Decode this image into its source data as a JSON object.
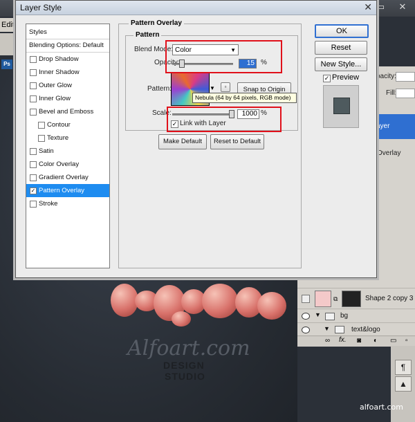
{
  "photoshop": {
    "menu_edit": "Edit",
    "app_badge": "Ps",
    "win_controls": [
      "—",
      "▭",
      "✕"
    ],
    "panel_opacity_label": "pacity:",
    "panel_fill_label": "Fill:",
    "selected_layer_fragment": "ayer",
    "overlay_fragment": "Overlay",
    "layers": [
      {
        "name": "Shape 2 copy 3"
      },
      {
        "name": "bg"
      },
      {
        "name": "text&logo"
      }
    ],
    "footer_icons": [
      "link-icon",
      "fx-icon",
      "mask-icon",
      "adjustment-icon",
      "folder-icon",
      "new-layer-icon",
      "trash-icon"
    ],
    "fx_label": "fx.",
    "tool_glyphs": [
      "¶",
      "▲"
    ]
  },
  "artwork": {
    "watermark": "Alfoart.com",
    "design": "DESIGN",
    "studio": "STUDIO"
  },
  "credit": "alfoart.com",
  "dialog": {
    "title": "Layer Style",
    "close_glyph": "✕",
    "styles_list": [
      {
        "label": "Styles",
        "type": "head"
      },
      {
        "label": "Blending Options: Default",
        "type": "head"
      },
      {
        "label": "Drop Shadow",
        "checked": false
      },
      {
        "label": "Inner Shadow",
        "checked": false
      },
      {
        "label": "Outer Glow",
        "checked": false
      },
      {
        "label": "Inner Glow",
        "checked": false
      },
      {
        "label": "Bevel and Emboss",
        "checked": false
      },
      {
        "label": "Contour",
        "checked": false,
        "indent": true
      },
      {
        "label": "Texture",
        "checked": false,
        "indent": true
      },
      {
        "label": "Satin",
        "checked": false
      },
      {
        "label": "Color Overlay",
        "checked": false
      },
      {
        "label": "Gradient Overlay",
        "checked": false
      },
      {
        "label": "Pattern Overlay",
        "checked": true,
        "selected": true
      },
      {
        "label": "Stroke",
        "checked": false
      }
    ],
    "group_title": "Pattern Overlay",
    "section_title": "Pattern",
    "blend_mode_label": "Blend Mode:",
    "blend_mode_value": "Color",
    "opacity_label": "Opacity:",
    "opacity_value": "15",
    "opacity_unit": "%",
    "opacity_level": 0.15,
    "pattern_label": "Pattern:",
    "pattern_tooltip": "Nebula (64 by 64 pixels, RGB mode)",
    "snap_button": "Snap to Origin",
    "scale_label": "Scale:",
    "scale_value": "1000",
    "scale_unit": "%",
    "link_with_layer_label": "Link with Layer",
    "link_with_layer_checked": true,
    "make_default_button": "Make Default",
    "reset_default_button": "Reset to Default",
    "ok_button": "OK",
    "reset_button": "Reset",
    "new_style_button": "New Style...",
    "preview_label": "Preview",
    "preview_checked": true,
    "highlight_color": "#e0101a",
    "selection_color": "#1e8cf0"
  }
}
